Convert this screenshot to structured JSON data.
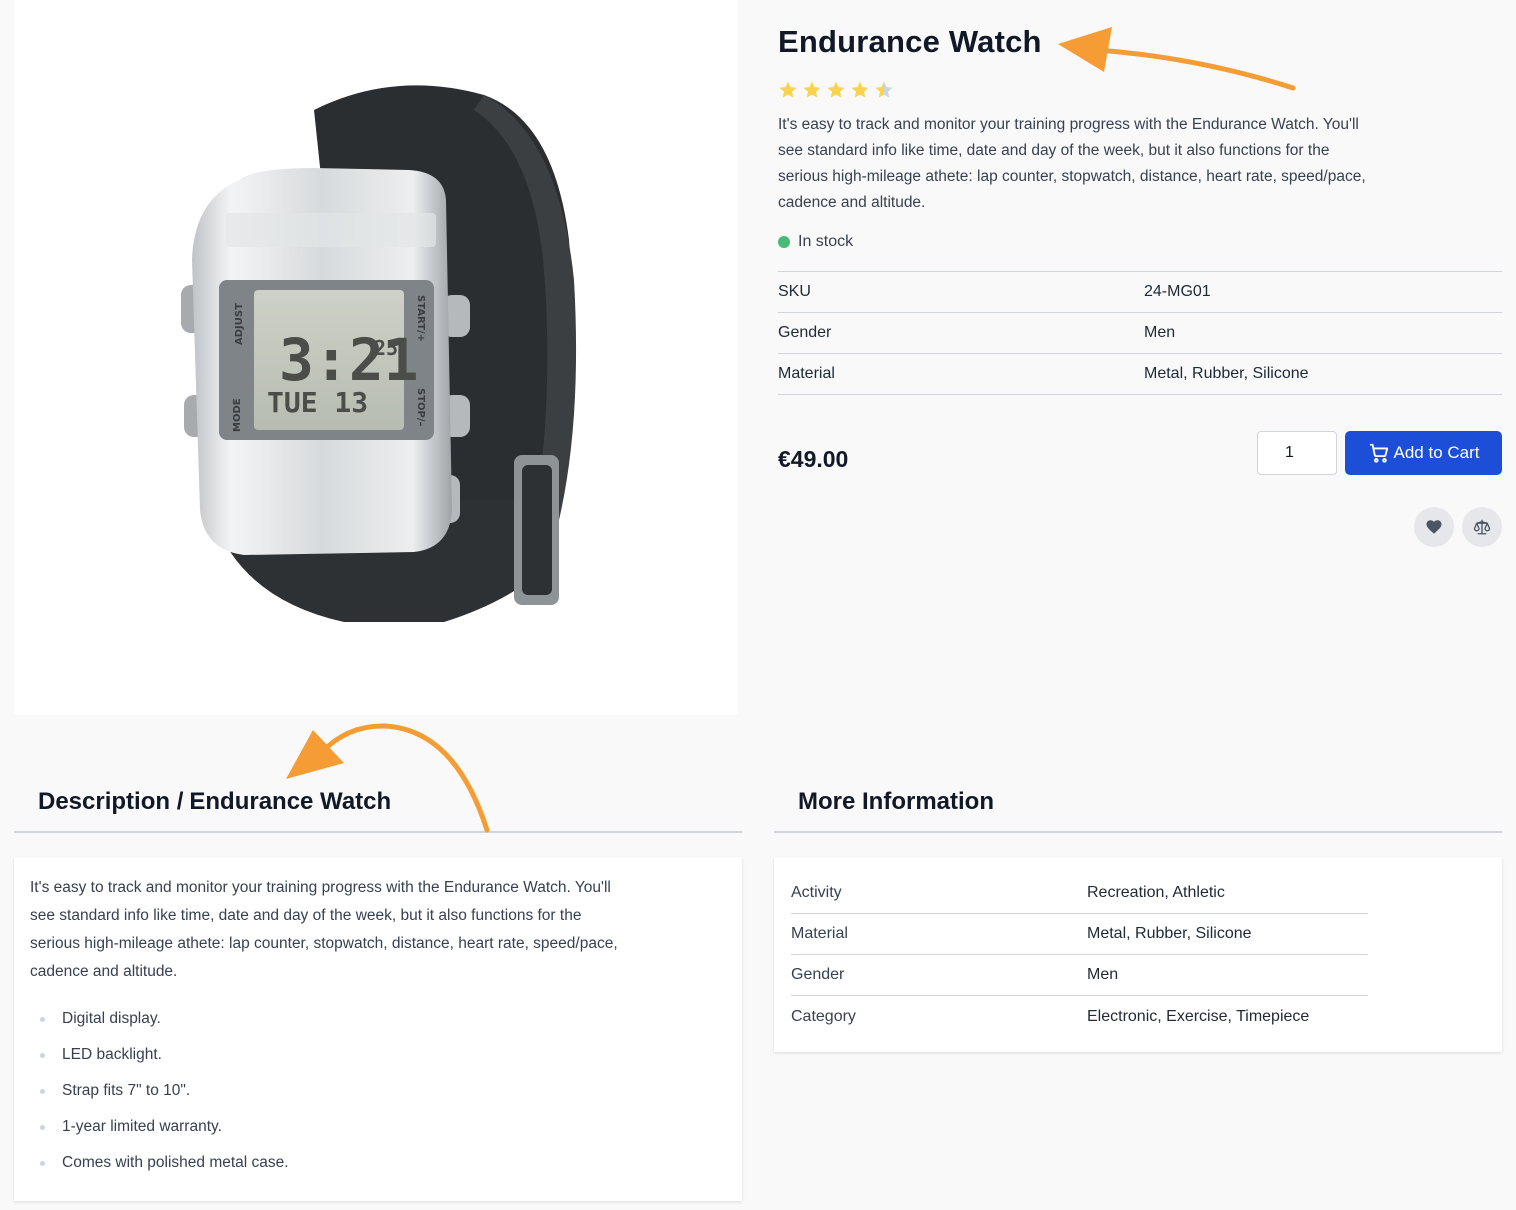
{
  "product": {
    "title": "Endurance Watch",
    "rating": 4.5,
    "rating_max": 5,
    "description": "It's easy to track and monitor your training progress with the Endurance Watch. You'll see standard info like time, date and day of the week, but it also functions for the serious high-mileage athete: lap counter, stopwatch, distance, heart rate, speed/pace, cadence and altitude.",
    "stock": "In stock",
    "attributes": [
      {
        "label": "SKU",
        "value": "24-MG01"
      },
      {
        "label": "Gender",
        "value": "Men"
      },
      {
        "label": "Material",
        "value": "Metal, Rubber, Silicone"
      }
    ],
    "price": "€49.00",
    "quantity": "1",
    "add_to_cart": "Add to Cart"
  },
  "watch_display": {
    "left_top": "ADJUST",
    "left_bottom": "MODE",
    "right_top": "START/+",
    "right_bottom": "STOP/–",
    "time": "3:21",
    "seconds": "25",
    "date": "TUE 13"
  },
  "description_section": {
    "prefix": "Description /",
    "product_name": "Endurance Watch",
    "text": "It's easy to track and monitor your training progress with the Endurance Watch. You'll see standard info like time, date and day of the week, but it also functions for the serious high-mileage athete: lap counter, stopwatch, distance, heart rate, speed/pace, cadence and altitude.",
    "features": [
      "Digital display.",
      "LED backlight.",
      "Strap fits 7\" to 10\".",
      "1-year limited warranty.",
      "Comes with polished metal case."
    ]
  },
  "more_information": {
    "title": "More Information",
    "rows": [
      {
        "label": "Activity",
        "value": "Recreation, Athletic"
      },
      {
        "label": "Material",
        "value": "Metal, Rubber, Silicone"
      },
      {
        "label": "Gender",
        "value": "Men"
      },
      {
        "label": "Category",
        "value": "Electronic, Exercise, Timepiece"
      }
    ]
  },
  "colors": {
    "accent": "#1d4ed8",
    "star": "#fcd34d",
    "in_stock": "#48bb78",
    "annotation_arrow": "#f59c34"
  },
  "icons": {
    "cart": "cart-icon",
    "wishlist": "heart-icon",
    "compare": "scale-icon"
  }
}
